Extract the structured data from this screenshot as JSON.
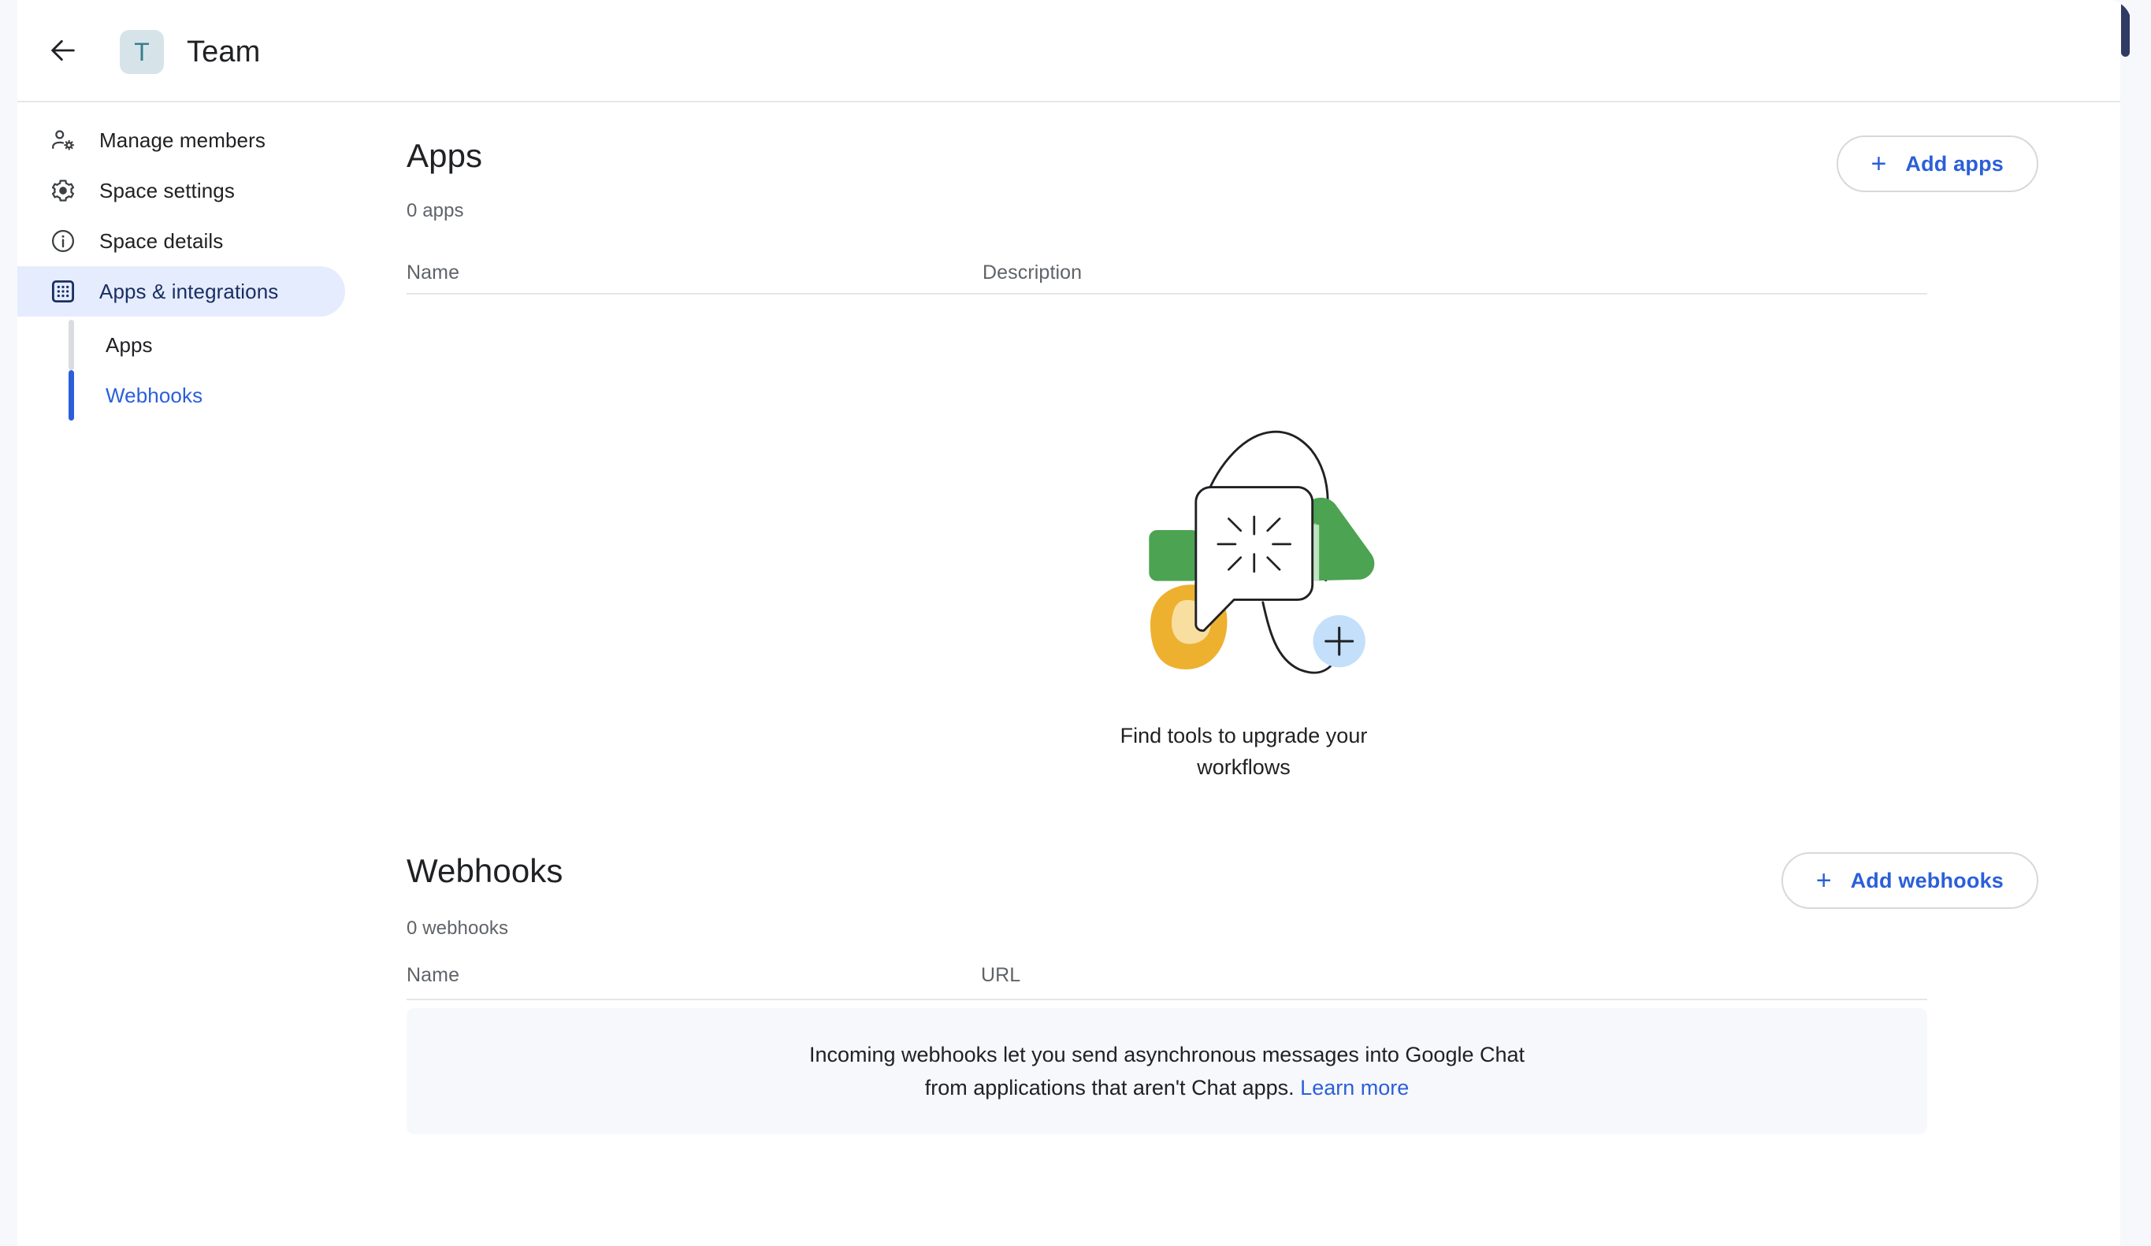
{
  "header": {
    "back_icon": "arrow-left-icon",
    "avatar_letter": "T",
    "title": "Team"
  },
  "sidebar": {
    "items": [
      {
        "label": "Manage members",
        "icon": "manage-members-icon",
        "active": false
      },
      {
        "label": "Space settings",
        "icon": "gear-icon",
        "active": false
      },
      {
        "label": "Space details",
        "icon": "info-icon",
        "active": false
      },
      {
        "label": "Apps & integrations",
        "icon": "apps-grid-icon",
        "active": true
      }
    ],
    "sub_items": [
      {
        "label": "Apps",
        "selected": false
      },
      {
        "label": "Webhooks",
        "selected": true
      }
    ]
  },
  "apps_section": {
    "title": "Apps",
    "count": "0 apps",
    "add_button": {
      "label": "Add apps",
      "plus": "+"
    },
    "columns": {
      "name": "Name",
      "description": "Description"
    },
    "empty_state": {
      "text": "Find tools to upgrade your workflows",
      "illustration": "apps-empty-illustration"
    }
  },
  "webhooks_section": {
    "title": "Webhooks",
    "count": "0 webhooks",
    "add_button": {
      "label": "Add webhooks",
      "plus": "+"
    },
    "columns": {
      "name": "Name",
      "url": "URL"
    },
    "banner": {
      "text": "Incoming webhooks let you send asynchronous messages into Google Chat from applications that aren't Chat apps.",
      "link_label": "Learn more"
    }
  },
  "colors": {
    "accent_blue": "#2b5fd9",
    "active_nav_bg": "#e5ecfd",
    "active_nav_text": "#1a2f63",
    "page_bg": "#f6f8fc",
    "banner_bg": "#f7f8fc",
    "illustration_green": "#4ca352",
    "illustration_green_light": "#c5e6c8",
    "illustration_yellow": "#edb12f",
    "illustration_yellow_light": "#f8dfa0",
    "illustration_blue": "#c3dffa",
    "avatar_bg": "#d6e4e9",
    "avatar_text": "#3a7d8c"
  }
}
